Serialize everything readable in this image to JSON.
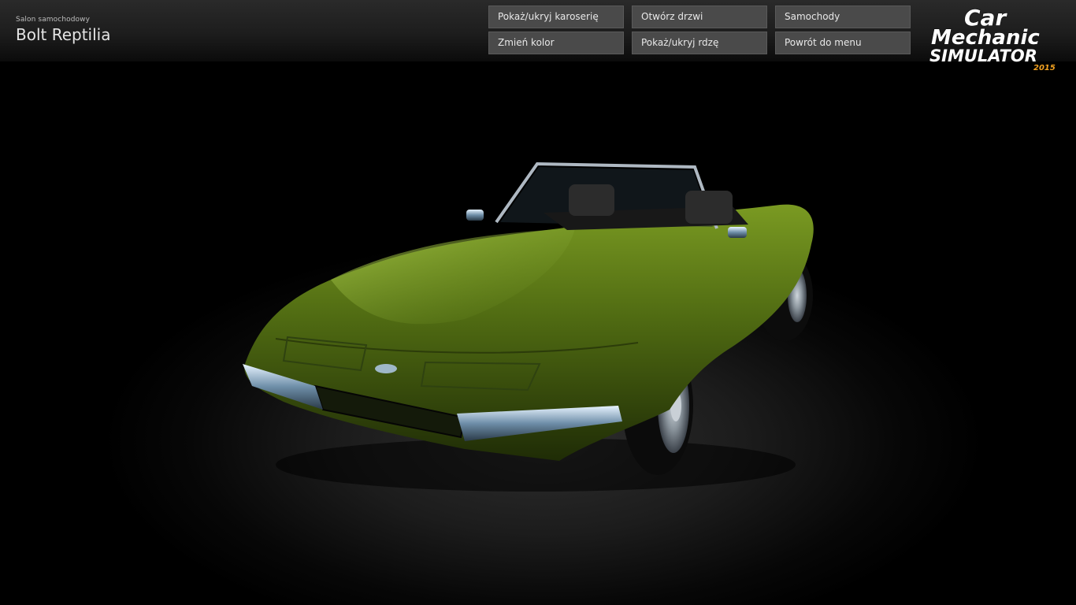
{
  "header": {
    "subtitle": "Salon samochodowy",
    "car_name": "Bolt Reptilia"
  },
  "menu": {
    "items": [
      {
        "label": "Pokaż/ukryj karoserię"
      },
      {
        "label": "Otwórz drzwi"
      },
      {
        "label": "Samochody"
      },
      {
        "label": "Zmień kolor"
      },
      {
        "label": "Pokaż/ukryj rdzę"
      },
      {
        "label": "Powrót do menu"
      }
    ]
  },
  "logo": {
    "line1": "Car",
    "line2": "Mechanic",
    "line3": "SIMULATOR",
    "year": "2015"
  },
  "colors": {
    "car_body": "#4f6a12",
    "logo_year": "#f0a020",
    "button_bg": "#4a4a4a"
  }
}
